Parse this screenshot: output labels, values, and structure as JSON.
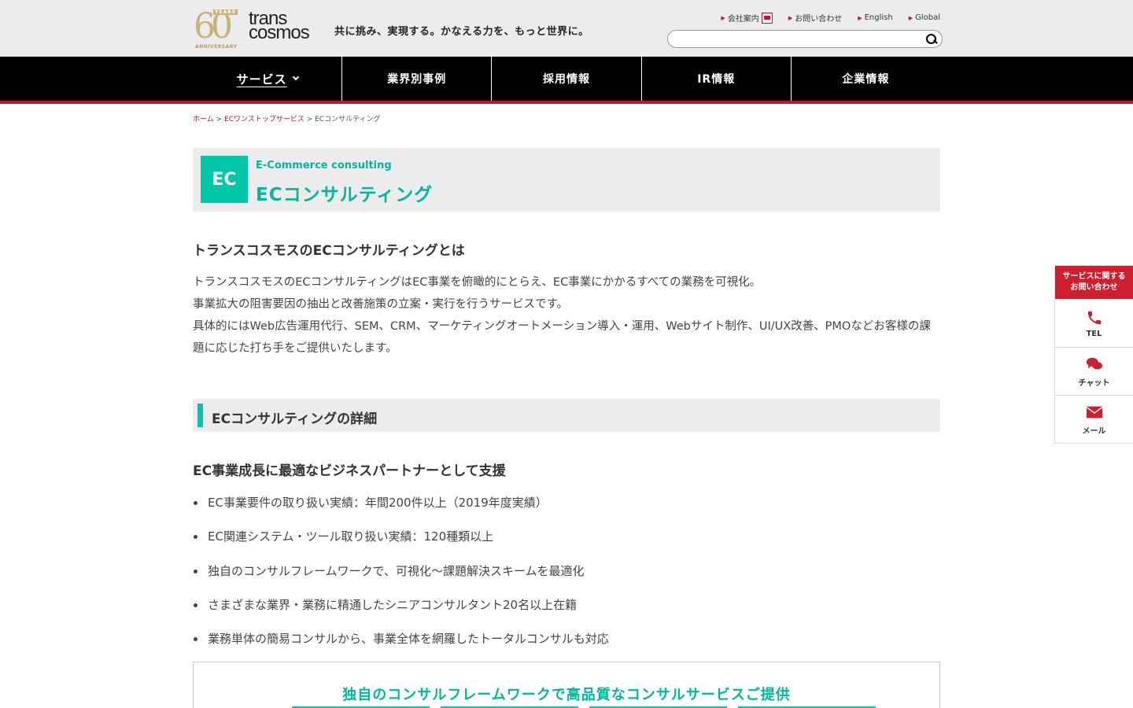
{
  "header": {
    "logo_years": "YEARS",
    "logo_number": "60",
    "logo_anniversary": "ANNIVERSARY",
    "brand_line1": "trans",
    "brand_line2": "cosmos",
    "tagline": "共に挑み、実現する。かなえる力を、もっと世界に。",
    "util_links": [
      "会社案内",
      "お問い合わせ",
      "English",
      "Global"
    ],
    "search_placeholder": ""
  },
  "nav": {
    "items": [
      "サービス",
      "業界別事例",
      "採用情報",
      "IR情報",
      "企業情報"
    ]
  },
  "breadcrumb": {
    "home": "ホーム",
    "sep": ">",
    "parent": "ECワンストップサービス",
    "current": "ECコンサルティング"
  },
  "title": {
    "badge": "EC",
    "subtitle": "E-Commerce consulting",
    "main": "ECコンサルティング"
  },
  "content": {
    "about_heading": "トランスコスモスのECコンサルティングとは",
    "intro_lines": [
      "トランスコスモスのECコンサルティングはEC事業を俯瞰的にとらえ、EC事業にかかるすべての業務を可視化。",
      "事業拡大の阻害要因の抽出と改善施策の立案・実行を行うサービスです。",
      "具体的にはWeb広告運用代行、SEM、CRM、マーケティングオートメーション導入・運用、Webサイト制作、UI/UX改善、PMOなどお客様の課題に応じた打ち手をご提供いたします。"
    ],
    "detail_heading": "ECコンサルティングの詳細",
    "support_heading": "EC事業成長に最適なビジネスパートナーとして支援",
    "bullets": [
      "EC事業要件の取り扱い実績：年間200件以上（2019年度実績）",
      "EC関連システム・ツール取り扱い実績：120種類以上",
      "独自のコンサルフレームワークで、可視化～課題解決スキームを最適化",
      "さまざまな業界・業務に精通したシニアコンサルタント20名以上在籍",
      "業務単体の簡易コンサルから、事業全体を網羅したトータルコンサルも対応"
    ],
    "framework_title": "独自のコンサルフレームワークで高品質なコンサルサービスご提供"
  },
  "side_contact": {
    "head_line1": "サービスに関する",
    "head_line2": "お問い合わせ",
    "tel": "TEL",
    "chat": "チャット",
    "mail": "メール"
  },
  "colors": {
    "accent": "#00c7a8",
    "brand_red": "#c8102e",
    "nav_bg": "#000000"
  }
}
